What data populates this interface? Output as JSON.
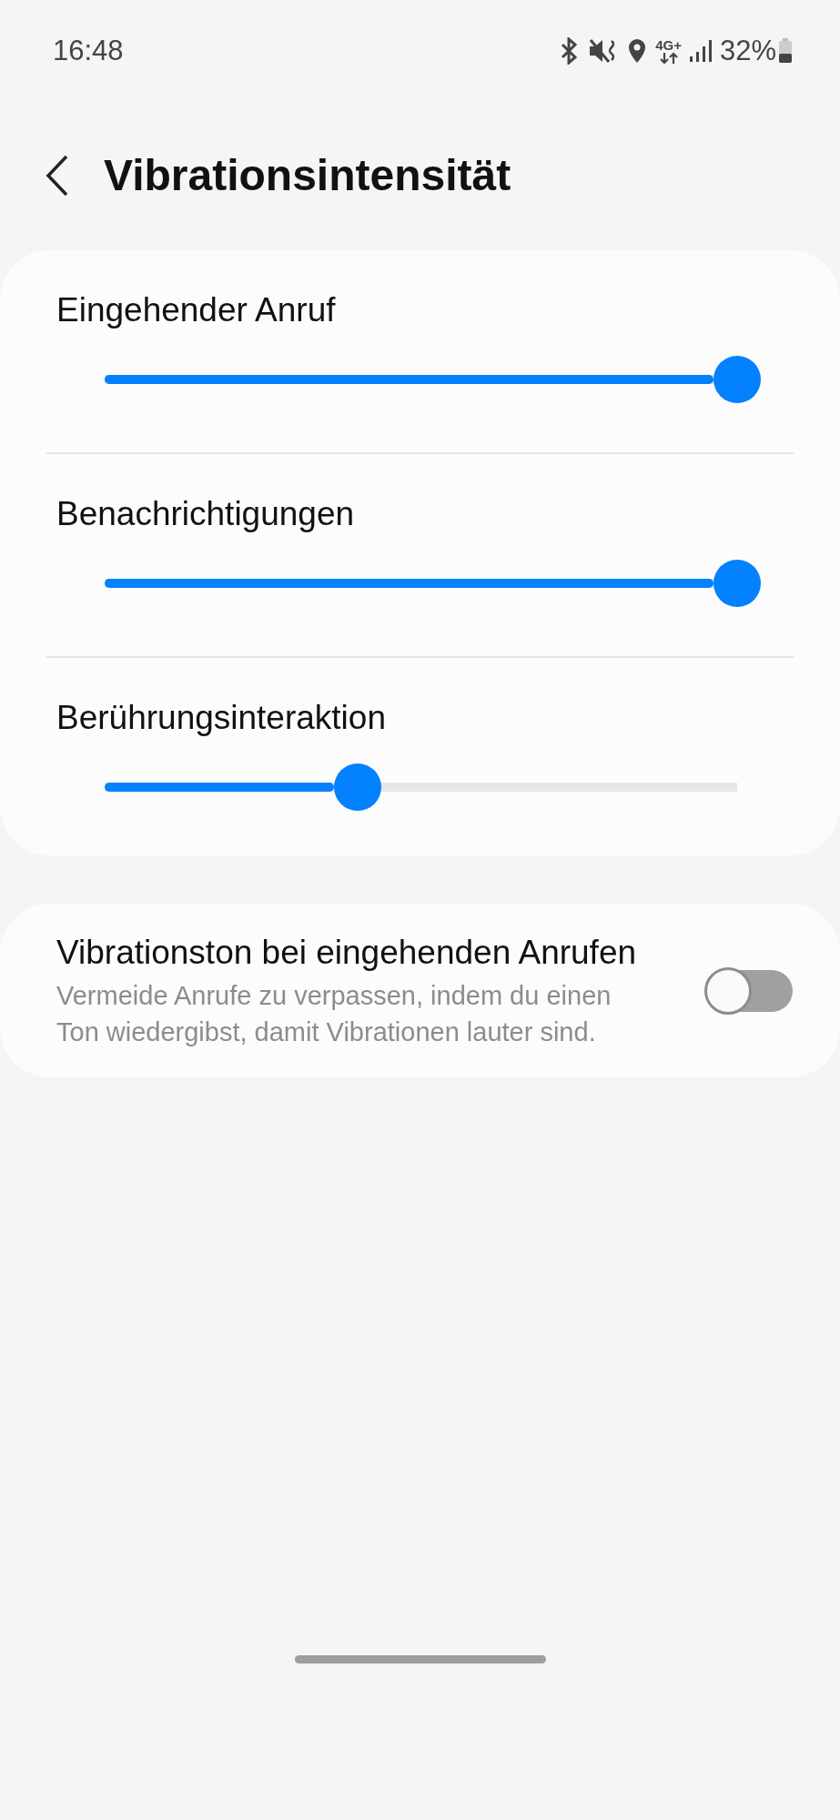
{
  "status_bar": {
    "time": "16:48",
    "network": "4G+",
    "battery": "32%"
  },
  "header": {
    "title": "Vibrationsintensität"
  },
  "sliders": [
    {
      "label": "Eingehender Anruf",
      "level": 1.0
    },
    {
      "label": "Benachrichtigungen",
      "level": 1.0
    },
    {
      "label": "Berührungsinteraktion",
      "level": 0.4
    }
  ],
  "toggle_setting": {
    "title": "Vibrationston bei eingehenden Anrufen",
    "description": "Vermeide Anrufe zu verpassen, indem du einen Ton wiedergibst, damit Vibrationen lauter sind.",
    "on": false
  }
}
